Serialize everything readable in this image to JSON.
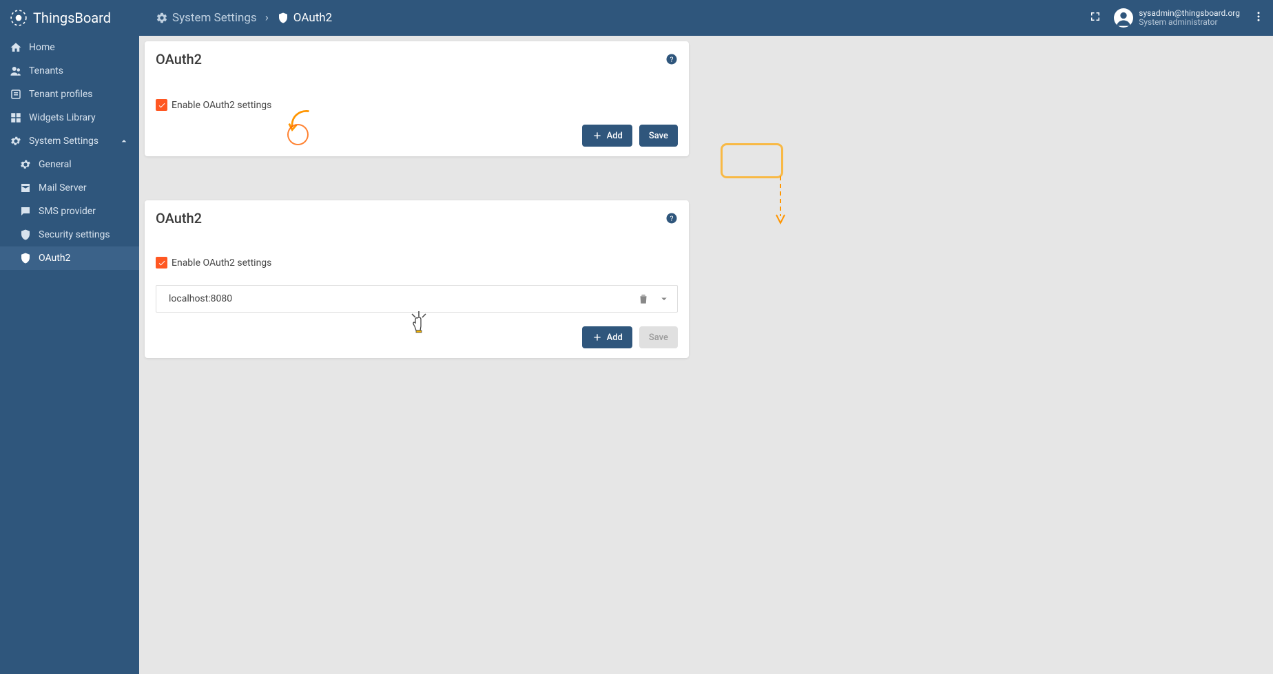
{
  "app": {
    "name": "ThingsBoard"
  },
  "breadcrumb": {
    "parent": "System Settings",
    "current": "OAuth2"
  },
  "user": {
    "email": "sysadmin@thingsboard.org",
    "role": "System administrator"
  },
  "sidebar": {
    "items": [
      {
        "label": "Home",
        "icon": "home"
      },
      {
        "label": "Tenants",
        "icon": "supervisor"
      },
      {
        "label": "Tenant profiles",
        "icon": "tprofile"
      },
      {
        "label": "Widgets Library",
        "icon": "widgets"
      },
      {
        "label": "System Settings",
        "icon": "gear",
        "expanded": true
      }
    ],
    "sub": [
      {
        "label": "General",
        "icon": "gear"
      },
      {
        "label": "Mail Server",
        "icon": "mail"
      },
      {
        "label": "SMS provider",
        "icon": "sms"
      },
      {
        "label": "Security settings",
        "icon": "shield"
      },
      {
        "label": "OAuth2",
        "icon": "shield",
        "active": true
      }
    ]
  },
  "card1": {
    "title": "OAuth2",
    "checkbox_label": "Enable OAuth2 settings",
    "add_label": "Add",
    "save_label": "Save"
  },
  "card2": {
    "title": "OAuth2",
    "checkbox_label": "Enable OAuth2 settings",
    "domain": "localhost:8080",
    "add_label": "Add",
    "save_label": "Save"
  }
}
